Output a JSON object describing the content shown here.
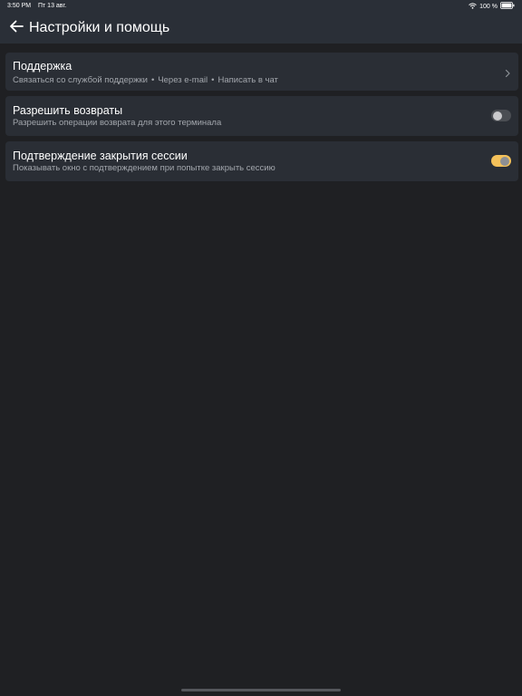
{
  "status_bar": {
    "time": "3:50 PM",
    "date": "Пт 13 авг.",
    "battery": "100 %"
  },
  "nav": {
    "title": "Настройки и помощь"
  },
  "rows": [
    {
      "title": "Поддержка",
      "subtitle_parts": [
        "Связаться со службой поддержки",
        "Через e-mail",
        "Написать в чат"
      ],
      "control": "chevron"
    },
    {
      "title": "Разрешить возвраты",
      "subtitle": "Разрешить операции возврата для этого терминала",
      "control": "toggle",
      "toggle_on": false
    },
    {
      "title": "Подтверждение закрытия сессии",
      "subtitle": "Показывать окно с подтверждением при попытке закрыть сессию",
      "control": "toggle",
      "toggle_on": true
    }
  ],
  "subtitle_separator": "•",
  "colors": {
    "background": "#1f2023",
    "bar": "#2a2f37",
    "card": "#2a2e35",
    "accent_toggle": "#f4c15a",
    "subtitle_text": "#a3a7ad"
  }
}
